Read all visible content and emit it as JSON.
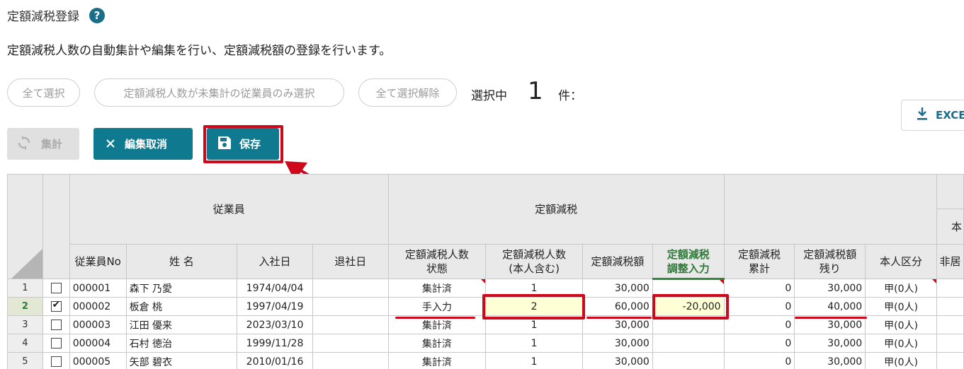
{
  "page": {
    "title": "定額減税登録",
    "help_icon": "?",
    "description": "定額減税人数の自動集計や編集を行い、定額減税額の登録を行います。"
  },
  "selection": {
    "select_all": "全て選択",
    "select_uncounted": "定額減税人数が未集計の従業員のみ選択",
    "deselect_all": "全て選択解除",
    "selected_label": "選択中",
    "selected_count": "1",
    "selected_unit": "件："
  },
  "toolbar": {
    "aggregate_label": "集計",
    "cancel_edit_label": "編集取消",
    "save_label": "保存",
    "excel_label": "EXCE"
  },
  "grid": {
    "group_headers": {
      "employee": "従業員",
      "tax_reduction": "定額減税",
      "right_partial": "本"
    },
    "columns": [
      "従業員No",
      "姓 名",
      "入社日",
      "退社日",
      "定額減税人数状態",
      "定額減税人数(本人含む)",
      "定額減税額",
      "定額減税調整入力",
      "定額減税累計",
      "定額減税額残り",
      "本人区分",
      "非居"
    ],
    "column_header_lines": {
      "status": [
        "定額減税人数",
        "状態"
      ],
      "count": [
        "定額減税人数",
        "(本人含む)"
      ],
      "adjust": [
        "定額減税",
        "調整入力"
      ],
      "cumulative": [
        "定額減税",
        "累計"
      ],
      "remaining": [
        "定額減税額",
        "残り"
      ]
    },
    "rows": [
      {
        "num": "1",
        "checked": false,
        "emp_no": "000001",
        "name": "森下 乃愛",
        "hire_date": "1974/04/04",
        "leave_date": "",
        "status": "集計済",
        "count": "1",
        "amount": "30,000",
        "adjust": "",
        "cumulative": "0",
        "remaining": "30,000",
        "category": "甲(0人)"
      },
      {
        "num": "2",
        "checked": true,
        "emp_no": "000002",
        "name": "板倉 桃",
        "hire_date": "1997/04/19",
        "leave_date": "",
        "status": "手入力",
        "count": "2",
        "amount": "60,000",
        "adjust": "-20,000",
        "cumulative": "0",
        "remaining": "40,000",
        "category": "甲(0人)"
      },
      {
        "num": "3",
        "checked": false,
        "emp_no": "000003",
        "name": "江田 優来",
        "hire_date": "2023/03/10",
        "leave_date": "",
        "status": "集計済",
        "count": "1",
        "amount": "30,000",
        "adjust": "",
        "cumulative": "0",
        "remaining": "30,000",
        "category": "甲(0人)"
      },
      {
        "num": "4",
        "checked": false,
        "emp_no": "000004",
        "name": "石村 徳治",
        "hire_date": "1999/11/28",
        "leave_date": "",
        "status": "集計済",
        "count": "1",
        "amount": "30,000",
        "adjust": "",
        "cumulative": "0",
        "remaining": "30,000",
        "category": "甲(0人)"
      },
      {
        "num": "5",
        "checked": false,
        "emp_no": "000005",
        "name": "矢部 碧衣",
        "hire_date": "2010/01/16",
        "leave_date": "",
        "status": "集計済",
        "count": "1",
        "amount": "30,000",
        "adjust": "",
        "cumulative": "0",
        "remaining": "30,000",
        "category": "甲(0人)"
      }
    ]
  },
  "colors": {
    "accent": "#0f7a8f",
    "highlight_red": "#d0081b",
    "input_yellow": "#ffffd6",
    "header_green": "#2e7a38"
  }
}
